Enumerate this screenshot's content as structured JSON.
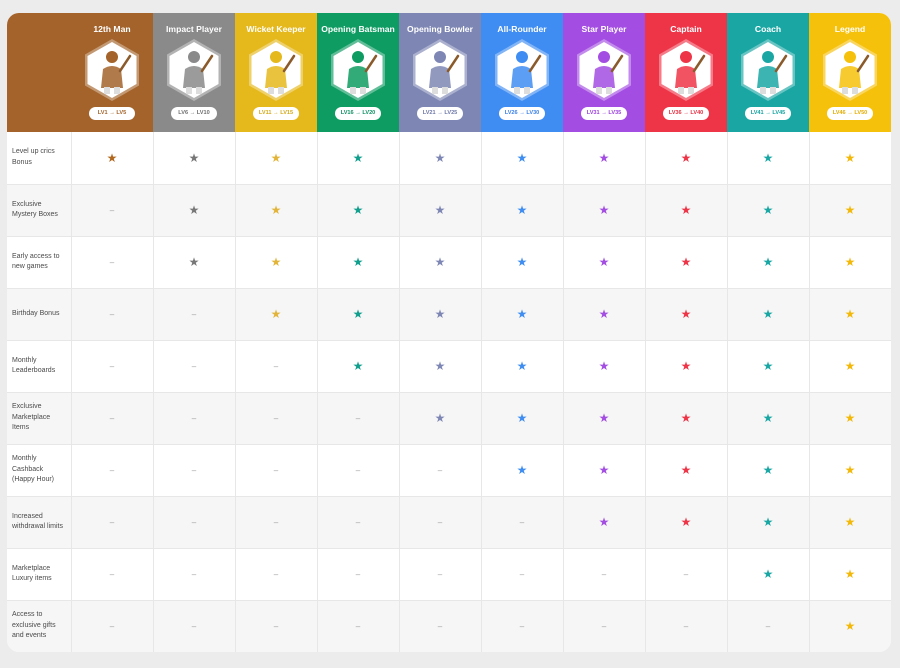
{
  "tiers": [
    {
      "name": "12th Man",
      "levels": "LV1 → LV5",
      "color": "#a3632a",
      "pill_text_color": "#a3632a",
      "avatar": "batsman-avatar-icon"
    },
    {
      "name": "Impact Player",
      "levels": "LV6 → LV10",
      "color": "#8a8a8a",
      "pill_text_color": "#6f6f6f",
      "avatar": "batsman-avatar-icon"
    },
    {
      "name": "Wicket Keeper",
      "levels": "LV11 → LV15",
      "color": "#e5b81c",
      "pill_text_color": "#d4a818",
      "avatar": "wicket-keeper-avatar-icon"
    },
    {
      "name": "Opening Batsman",
      "levels": "LV16 → LV20",
      "color": "#0e9c62",
      "pill_text_color": "#0e8f62",
      "avatar": "batsman-avatar-icon"
    },
    {
      "name": "Opening Bowler",
      "levels": "LV21 → LV25",
      "color": "#7e87b4",
      "pill_text_color": "#6e78a8",
      "avatar": "bowler-avatar-icon"
    },
    {
      "name": "All-Rounder",
      "levels": "LV26 → LV30",
      "color": "#3f8df2",
      "pill_text_color": "#3a80e8",
      "avatar": "all-rounder-avatar-icon"
    },
    {
      "name": "Star Player",
      "levels": "LV31 → LV35",
      "color": "#a34de2",
      "pill_text_color": "#9b40de",
      "avatar": "star-player-avatar-icon"
    },
    {
      "name": "Captain",
      "levels": "LV36 → LV40",
      "color": "#ee3548",
      "pill_text_color": "#e62e40",
      "avatar": "captain-avatar-icon"
    },
    {
      "name": "Coach",
      "levels": "LV41 → LV45",
      "color": "#1aa7a4",
      "pill_text_color": "#14a3a0",
      "avatar": "coach-avatar-icon"
    },
    {
      "name": "Legend",
      "levels": "LV46 → LV50",
      "color": "#f6c10b",
      "pill_text_color": "#e3ad00",
      "avatar": "legend-avatar-icon"
    }
  ],
  "star_colors": [
    "#b0681f",
    "#777777",
    "#e2b43a",
    "#119e8c",
    "#7e87b4",
    "#3f8df2",
    "#a34de2",
    "#ee3548",
    "#1aa7a4",
    "#f2b90b"
  ],
  "symbols": {
    "included": "★",
    "excluded": "–"
  },
  "perks": [
    {
      "label": "Level up crics Bonus",
      "available_from_tier": 1
    },
    {
      "label": "Exclusive Mystery Boxes",
      "available_from_tier": 2
    },
    {
      "label": "Early access to new games",
      "available_from_tier": 2
    },
    {
      "label": "Birthday Bonus",
      "available_from_tier": 3
    },
    {
      "label": "Monthly Leaderboards",
      "available_from_tier": 4
    },
    {
      "label": "Exclusive Marketplace Items",
      "available_from_tier": 5
    },
    {
      "label": "Monthly Cashback (Happy Hour)",
      "available_from_tier": 6
    },
    {
      "label": "Increased withdrawal limits",
      "available_from_tier": 7
    },
    {
      "label": "Marketplace Luxury items",
      "available_from_tier": 9
    },
    {
      "label": "Access to exclusive gifts and events",
      "available_from_tier": 10
    }
  ]
}
